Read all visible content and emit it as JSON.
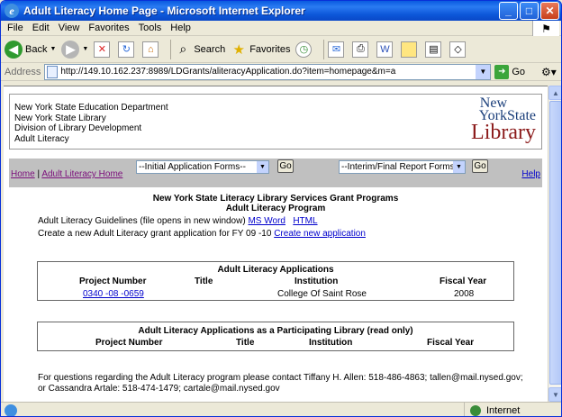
{
  "window": {
    "title": "Adult Literacy Home Page - Microsoft Internet Explorer",
    "min_label": "_",
    "max_label": "□",
    "close_label": "✕"
  },
  "menu": [
    "File",
    "Edit",
    "View",
    "Favorites",
    "Tools",
    "Help"
  ],
  "toolbar": {
    "back_label": "Back",
    "search_label": "Search",
    "favorites_label": "Favorites"
  },
  "address": {
    "label": "Address",
    "url": "http://149.10.162.237:8989/LDGrants/aliteracyApplication.do?item=homepage&m=a",
    "go_label": "Go"
  },
  "header": {
    "lines": [
      "New York State Education Department",
      "New York State Library",
      "Division of Library Development",
      "Adult Literacy"
    ],
    "logo": {
      "line1": "New",
      "line2": "YorkState",
      "line3": "Library"
    }
  },
  "nav": {
    "home": "Home",
    "sep": "|",
    "adult_home": "Adult Literacy Home",
    "initial_forms": "--Initial Application Forms--",
    "interim_forms": "--Interim/Final Report Forms--",
    "go": "Go",
    "help": "Help"
  },
  "main": {
    "title1": "New York State Literacy Library Services Grant Programs",
    "title2": "Adult Literacy Program",
    "guidelines_text": "Adult Literacy Guidelines (file opens in new window)",
    "ms_word": "MS Word",
    "html": "HTML",
    "create_text": "Create a new Adult Literacy grant application for FY 09 -10",
    "create_link": "Create new application"
  },
  "applications": {
    "caption": "Adult Literacy Applications",
    "columns": [
      "Project Number",
      "Title",
      "Institution",
      "Fiscal Year"
    ],
    "rows": [
      {
        "project": "0340 -08 -0659",
        "title": "",
        "institution": "College Of Saint Rose",
        "fy": "2008"
      }
    ]
  },
  "participating": {
    "caption": "Adult Literacy Applications as a Participating Library (read only)",
    "columns": [
      "Project Number",
      "Title",
      "Institution",
      "Fiscal Year"
    ]
  },
  "footer": {
    "text": "For questions regarding the Adult Literacy program please contact Tiffany H. Allen: 518-486-4863; tallen@mail.nysed.gov; or Cassandra Artale: 518-474-1479; cartale@mail.nysed.gov"
  },
  "status": {
    "zone": "Internet"
  },
  "colors": {
    "titlebar": "#0a5ae0",
    "link": "#0000cc",
    "visited": "#7b0e7b",
    "nav_bg": "#c0c0c0"
  }
}
